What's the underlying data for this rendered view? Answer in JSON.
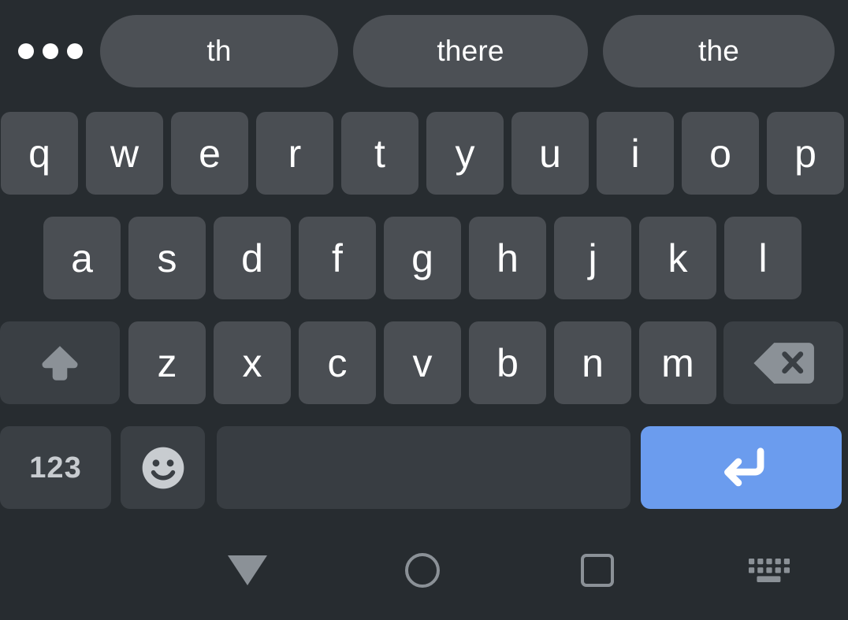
{
  "suggestions": {
    "more_icon": "more-horizontal-icon",
    "items": [
      {
        "label": "th"
      },
      {
        "label": "there"
      },
      {
        "label": "the"
      }
    ]
  },
  "keyboard": {
    "rows": [
      {
        "name": "row-1",
        "keys": [
          {
            "label": "q",
            "type": "letter"
          },
          {
            "label": "w",
            "type": "letter"
          },
          {
            "label": "e",
            "type": "letter"
          },
          {
            "label": "r",
            "type": "letter"
          },
          {
            "label": "t",
            "type": "letter"
          },
          {
            "label": "y",
            "type": "letter"
          },
          {
            "label": "u",
            "type": "letter"
          },
          {
            "label": "i",
            "type": "letter"
          },
          {
            "label": "o",
            "type": "letter"
          },
          {
            "label": "p",
            "type": "letter"
          }
        ]
      },
      {
        "name": "row-2",
        "keys": [
          {
            "label": "a",
            "type": "letter"
          },
          {
            "label": "s",
            "type": "letter"
          },
          {
            "label": "d",
            "type": "letter"
          },
          {
            "label": "f",
            "type": "letter"
          },
          {
            "label": "g",
            "type": "letter"
          },
          {
            "label": "h",
            "type": "letter"
          },
          {
            "label": "j",
            "type": "letter"
          },
          {
            "label": "k",
            "type": "letter"
          },
          {
            "label": "l",
            "type": "letter"
          }
        ]
      },
      {
        "name": "row-3",
        "keys": [
          {
            "label": "",
            "type": "shift",
            "icon": "shift-arrow-icon"
          },
          {
            "label": "z",
            "type": "letter"
          },
          {
            "label": "x",
            "type": "letter"
          },
          {
            "label": "c",
            "type": "letter"
          },
          {
            "label": "v",
            "type": "letter"
          },
          {
            "label": "b",
            "type": "letter"
          },
          {
            "label": "n",
            "type": "letter"
          },
          {
            "label": "m",
            "type": "letter"
          },
          {
            "label": "",
            "type": "backspace",
            "icon": "backspace-icon"
          }
        ]
      },
      {
        "name": "row-4",
        "keys": [
          {
            "label": "123",
            "type": "numeric-mode"
          },
          {
            "label": "",
            "type": "emoji",
            "icon": "emoji-smiley-icon"
          },
          {
            "label": "",
            "type": "space"
          },
          {
            "label": "",
            "type": "enter",
            "icon": "enter-return-icon"
          }
        ]
      }
    ]
  },
  "navbar": {
    "buttons": [
      {
        "name": "back",
        "icon": "triangle-down-icon"
      },
      {
        "name": "home",
        "icon": "circle-icon"
      },
      {
        "name": "recents",
        "icon": "square-icon"
      },
      {
        "name": "switch-keyboard",
        "icon": "keyboard-icon"
      }
    ]
  },
  "colors": {
    "background": "#272c30",
    "key": "#4a4e53",
    "function_key": "#3a3f44",
    "spacebar": "#383d42",
    "enter_accent": "#6b9cee",
    "suggestion_pill": "#4c5055",
    "key_text": "#ffffff",
    "icon_gray": "#8b9197"
  }
}
